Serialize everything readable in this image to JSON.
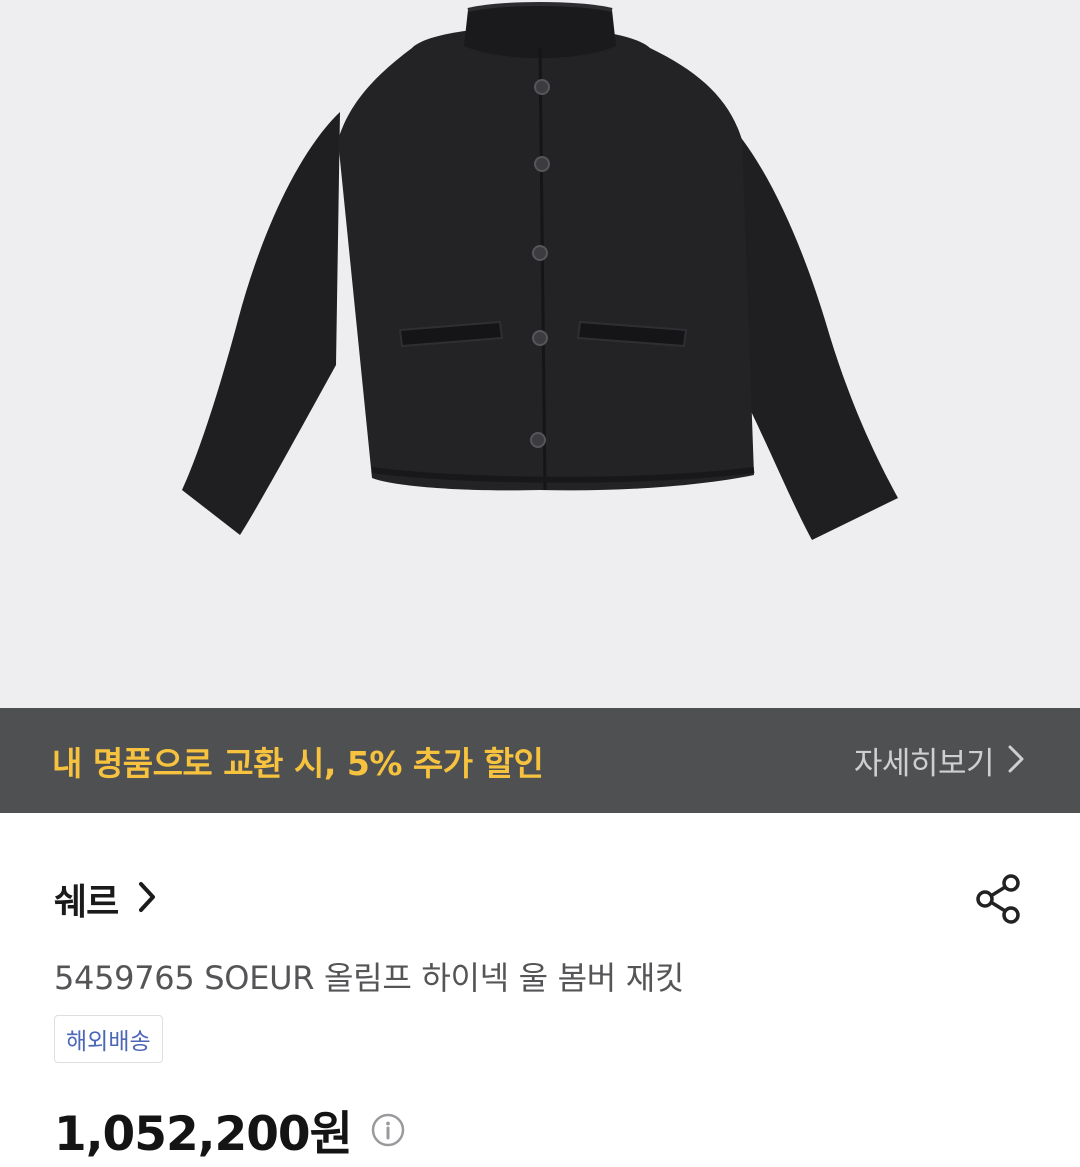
{
  "product_image": {
    "alt": "jacket-photo"
  },
  "promo_banner": {
    "text": "내 명품으로 교환 시, 5% 추가 할인",
    "link_label": "자세히보기",
    "text_color": "#f7c33f",
    "background": "#4f5052"
  },
  "product": {
    "brand": "쉐르",
    "title": "5459765 SOEUR 올림프 하이넥 울 봄버 재킷",
    "badge": "해외배송",
    "price": "1,052,200원"
  },
  "icons": {
    "brand_chevron": "chevron-right-icon",
    "share": "share-icon",
    "price_info": "info-icon",
    "promo_chevron": "chevron-right-icon"
  }
}
